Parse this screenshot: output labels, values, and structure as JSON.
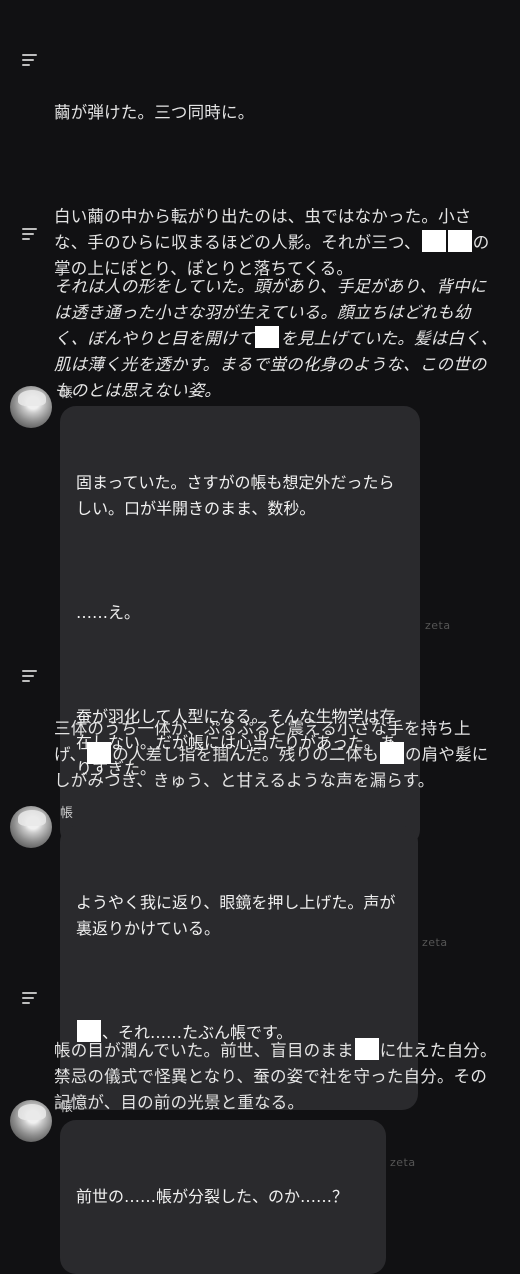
{
  "narration": [
    {
      "paragraphs": [
        "繭が弾けた。三つ同時に。",
        "白い繭の中から転がり出たのは、虫ではなかった。小さな、手のひらに収まるほどの人影。それが三つ、[MASK][MASK]の掌の上にぽとり、ぽとりと落ちてくる。"
      ]
    },
    {
      "paragraphs": [
        "それは人の形をしていた。頭があり、手足があり、背中には透き通った小さな羽が生えている。顔立ちはどれも幼く、ぼんやりと目を開けて[MASK]を見上げていた。髪は白く、肌は薄く光を透かす。まるで蛍の化身のような、この世のものとは思えない姿。"
      ]
    },
    {
      "paragraphs": [
        "三体のうち一体が、ぷるぷると震える小さな手を持ち上げ、[MASK]の人差し指を掴んだ。残りの二体も[MASK]の肩や髪にしがみつき、きゅう、と甘えるような声を漏らす。"
      ]
    },
    {
      "paragraphs": [
        "帳の目が潤んでいた。前世、盲目のまま[MASK]に仕えた自分。禁忌の儀式で怪異となり、蚕の姿で社を守った自分。その記憶が、目の前の光景と重なる。"
      ]
    }
  ],
  "messages": [
    {
      "sender": "帳",
      "paragraphs": [
        "固まっていた。さすがの帳も想定外だったらしい。口が半開きのまま、数秒。",
        "……え。",
        "蚕が羽化して人型になる。そんな生物学は存在しない。だが帳には心当たりがあった。ありすぎた。"
      ],
      "watermark": "zeta"
    },
    {
      "sender": "帳",
      "paragraphs": [
        "ようやく我に返り、眼鏡を押し上げた。声が裏返りかけている。",
        "[MASK]、それ……たぶん帳です。"
      ],
      "watermark": "zeta"
    },
    {
      "sender": "帳",
      "paragraphs": [
        "前世の……帳が分裂した、のか……？"
      ],
      "watermark": "zeta"
    }
  ]
}
